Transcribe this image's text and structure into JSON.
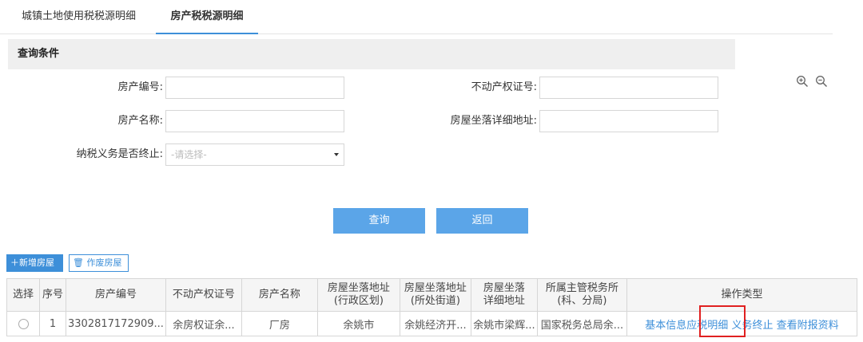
{
  "tabs": [
    {
      "label": "城镇土地使用税税源明细"
    },
    {
      "label": "房产税税源明细"
    }
  ],
  "panel": {
    "title": "查询条件"
  },
  "form": {
    "house_no_label": "房产编号:",
    "cert_no_label": "不动产权证号:",
    "house_name_label": "房产名称:",
    "address_label": "房屋坐落详细地址:",
    "terminated_label": "纳税义务是否终止:",
    "terminated_placeholder": "-请选择-"
  },
  "buttons": {
    "query": "查询",
    "back": "返回"
  },
  "toolbar": {
    "add": "新增房屋",
    "void": "作废房屋"
  },
  "table": {
    "headers": [
      "选择",
      "序号",
      "房产编号",
      "不动产权证号",
      "房产名称",
      "房屋坐落地址\n(行政区划)",
      "房屋坐落地址\n(所处街道)",
      "房屋坐落\n详细地址",
      "所属主管税务所\n(科、分局)",
      "操作类型"
    ],
    "rows": [
      {
        "seq": "1",
        "house_no": "3302817172909...",
        "cert_no": "余房权证余...",
        "name": "厂房",
        "district": "余姚市",
        "street": "余姚经济开...",
        "detail": "余姚市梁辉...",
        "tax_office": "国家税务总局余...",
        "ops": [
          "基本信息",
          "应税明细",
          "义务终止",
          "查看附报资料"
        ]
      }
    ]
  },
  "colors": {
    "accent": "#3d8fd9",
    "button": "#5ba5e8",
    "highlight": "#e02020"
  }
}
